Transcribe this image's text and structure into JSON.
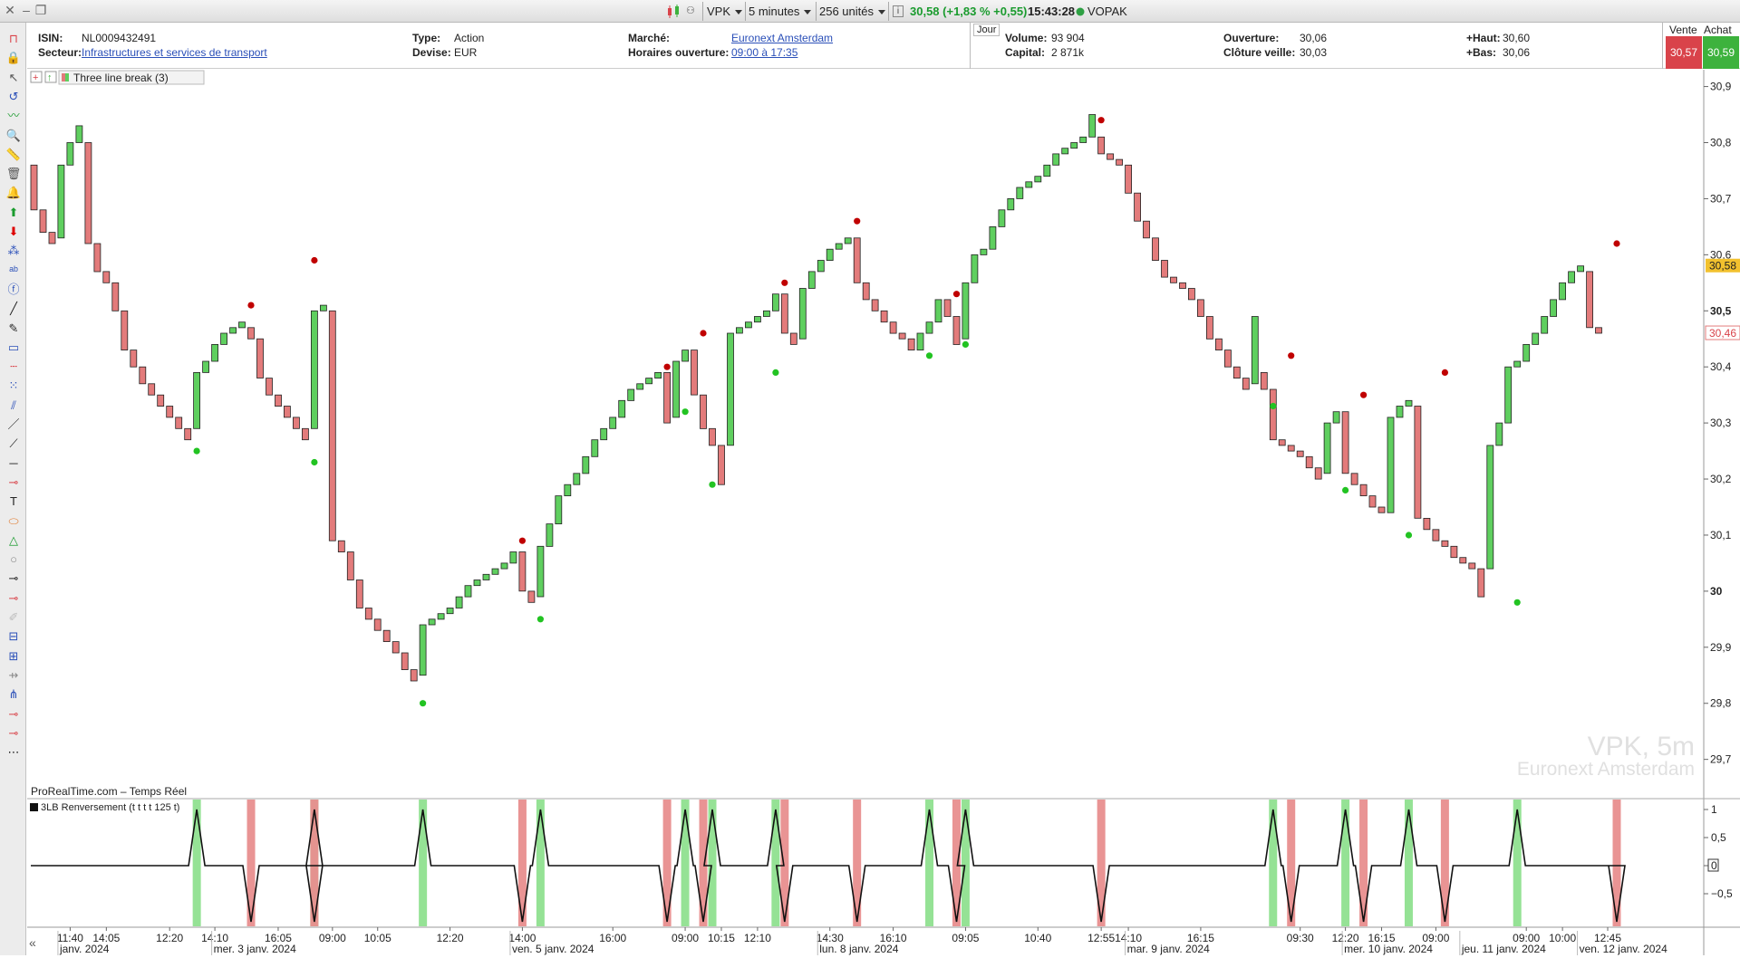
{
  "toolbar": {
    "symbol": "VPK",
    "interval": "5 minutes",
    "units": "256 unités",
    "last_price_change": "30,58 (+1,83 % +0,55)",
    "time": "15:43:28",
    "name": "VOPAK",
    "colors": {
      "positive": "#1a9b2e",
      "live_dot": "#2ea043"
    }
  },
  "info": {
    "isin_label": "ISIN:",
    "isin": "NL0009432491",
    "sector_label": "Secteur:",
    "sector": "Infrastructures et services de transport",
    "type_label": "Type:",
    "type": "Action",
    "currency_label": "Devise:",
    "currency": "EUR",
    "market_label": "Marché:",
    "market": "Euronext Amsterdam",
    "hours_label": "Horaires ouverture:",
    "hours": "09:00 à 17:35",
    "day_label": "Jour",
    "volume_label": "Volume:",
    "volume": "93 904",
    "capital_label": "Capital:",
    "capital": "2 871k",
    "open_label": "Ouverture:",
    "open": "30,06",
    "prev_close_label": "Clôture veille:",
    "prev_close": "30,03",
    "high_label": "+Haut:",
    "high": "30,60",
    "low_label": "+Bas:",
    "low": "30,06",
    "sell_label": "Vente",
    "sell": "30,57",
    "buy_label": "Achat",
    "buy": "30,59",
    "colors": {
      "sell": "#d9434a",
      "buy": "#3db23d"
    }
  },
  "left_tools": [
    "magnet-icon",
    "lock-icon",
    "cursor-icon",
    "rotate-icon",
    "trend-icon",
    "zoom-icon",
    "ruler-icon",
    "trash-icon",
    "alert-icon",
    "buy-arrow-icon",
    "sell-arrow-icon",
    "elliott-icon",
    "abc-icon",
    "fibonacci-icon",
    "pencil-icon",
    "eraser-icon",
    "rectangle-icon",
    "hline-icon",
    "pattern-icon",
    "channel-icon",
    "line-icon",
    "segment-icon",
    "horizontal-icon",
    "ray-icon",
    "text-icon",
    "ellipse-icon",
    "triangle-icon",
    "ray2-icon",
    "ray3-icon",
    "ray4-icon",
    "brush-icon",
    "fib-fan-icon",
    "gann-icon",
    "hline2-icon",
    "pitchfork-icon",
    "ray5-icon",
    "ray6-icon",
    "more-icon"
  ],
  "legend": {
    "indicator": "Three line break (3)",
    "watermark_symbol": "VPK, 5m",
    "watermark_market": "Euronext Amsterdam",
    "source": "ProRealTime.com – Temps Réel",
    "sub_indicator": "3LB Renversement (t t t t 125 t)"
  },
  "chart_data": {
    "type": "candlestick-three-line-break",
    "y_axis": {
      "ticks": [
        "30,9",
        "30,8",
        "30,7",
        "30,6",
        "30,5",
        "30,4",
        "30,3",
        "30,2",
        "30,1",
        "30",
        "29,9",
        "29,8",
        "29,7"
      ],
      "tick_values": [
        30.9,
        30.8,
        30.7,
        30.6,
        30.5,
        30.4,
        30.3,
        30.2,
        30.1,
        30.0,
        29.9,
        29.8,
        29.7
      ],
      "range": [
        29.63,
        30.93
      ]
    },
    "current_price": "30,58",
    "second_price": "30,46",
    "colors": {
      "up": "#5fcf5f",
      "down": "#e37b7b",
      "up_dot": "#22c322",
      "down_dot": "#c00000",
      "current": "#f2c12e"
    },
    "bricks": [
      [
        30.76,
        30.68,
        0
      ],
      [
        30.68,
        30.64,
        0
      ],
      [
        30.64,
        30.62,
        0
      ],
      [
        30.63,
        30.76,
        1
      ],
      [
        30.76,
        30.8,
        1
      ],
      [
        30.8,
        30.83,
        1
      ],
      [
        30.8,
        30.62,
        0
      ],
      [
        30.62,
        30.57,
        0
      ],
      [
        30.57,
        30.55,
        0
      ],
      [
        30.55,
        30.5,
        0
      ],
      [
        30.5,
        30.43,
        0
      ],
      [
        30.43,
        30.4,
        0
      ],
      [
        30.4,
        30.37,
        0
      ],
      [
        30.37,
        30.35,
        0
      ],
      [
        30.35,
        30.33,
        0
      ],
      [
        30.33,
        30.31,
        0
      ],
      [
        30.31,
        30.29,
        0
      ],
      [
        30.29,
        30.27,
        0
      ],
      [
        30.29,
        30.39,
        1
      ],
      [
        30.39,
        30.41,
        1
      ],
      [
        30.41,
        30.44,
        1
      ],
      [
        30.44,
        30.46,
        1
      ],
      [
        30.46,
        30.47,
        1
      ],
      [
        30.47,
        30.48,
        1
      ],
      [
        30.47,
        30.45,
        0
      ],
      [
        30.45,
        30.38,
        0
      ],
      [
        30.38,
        30.35,
        0
      ],
      [
        30.35,
        30.33,
        0
      ],
      [
        30.33,
        30.31,
        0
      ],
      [
        30.31,
        30.29,
        0
      ],
      [
        30.29,
        30.27,
        0
      ],
      [
        30.29,
        30.5,
        1
      ],
      [
        30.5,
        30.51,
        1
      ],
      [
        30.5,
        30.09,
        0
      ],
      [
        30.09,
        30.07,
        0
      ],
      [
        30.07,
        30.02,
        0
      ],
      [
        30.02,
        29.97,
        0
      ],
      [
        29.97,
        29.95,
        0
      ],
      [
        29.95,
        29.93,
        0
      ],
      [
        29.93,
        29.91,
        0
      ],
      [
        29.91,
        29.89,
        0
      ],
      [
        29.89,
        29.86,
        0
      ],
      [
        29.86,
        29.84,
        0
      ],
      [
        29.85,
        29.94,
        1
      ],
      [
        29.94,
        29.95,
        1
      ],
      [
        29.95,
        29.96,
        1
      ],
      [
        29.96,
        29.97,
        1
      ],
      [
        29.97,
        29.99,
        1
      ],
      [
        29.99,
        30.01,
        1
      ],
      [
        30.01,
        30.02,
        1
      ],
      [
        30.02,
        30.03,
        1
      ],
      [
        30.03,
        30.04,
        1
      ],
      [
        30.04,
        30.05,
        1
      ],
      [
        30.05,
        30.07,
        1
      ],
      [
        30.07,
        30.0,
        0
      ],
      [
        30.0,
        29.98,
        0
      ],
      [
        29.99,
        30.08,
        1
      ],
      [
        30.08,
        30.12,
        1
      ],
      [
        30.12,
        30.17,
        1
      ],
      [
        30.17,
        30.19,
        1
      ],
      [
        30.19,
        30.21,
        1
      ],
      [
        30.21,
        30.24,
        1
      ],
      [
        30.24,
        30.27,
        1
      ],
      [
        30.27,
        30.29,
        1
      ],
      [
        30.29,
        30.31,
        1
      ],
      [
        30.31,
        30.34,
        1
      ],
      [
        30.34,
        30.36,
        1
      ],
      [
        30.36,
        30.37,
        1
      ],
      [
        30.37,
        30.38,
        1
      ],
      [
        30.38,
        30.39,
        1
      ],
      [
        30.39,
        30.3,
        0
      ],
      [
        30.31,
        30.41,
        1
      ],
      [
        30.41,
        30.43,
        1
      ],
      [
        30.43,
        30.35,
        0
      ],
      [
        30.35,
        30.29,
        0
      ],
      [
        30.29,
        30.26,
        0
      ],
      [
        30.26,
        30.19,
        0
      ],
      [
        30.26,
        30.46,
        1
      ],
      [
        30.46,
        30.47,
        1
      ],
      [
        30.47,
        30.48,
        1
      ],
      [
        30.48,
        30.49,
        1
      ],
      [
        30.49,
        30.5,
        1
      ],
      [
        30.5,
        30.53,
        1
      ],
      [
        30.53,
        30.46,
        0
      ],
      [
        30.46,
        30.44,
        0
      ],
      [
        30.45,
        30.54,
        1
      ],
      [
        30.54,
        30.57,
        1
      ],
      [
        30.57,
        30.59,
        1
      ],
      [
        30.59,
        30.61,
        1
      ],
      [
        30.61,
        30.62,
        1
      ],
      [
        30.62,
        30.63,
        1
      ],
      [
        30.63,
        30.55,
        0
      ],
      [
        30.55,
        30.52,
        0
      ],
      [
        30.52,
        30.5,
        0
      ],
      [
        30.5,
        30.48,
        0
      ],
      [
        30.48,
        30.46,
        0
      ],
      [
        30.46,
        30.45,
        0
      ],
      [
        30.45,
        30.43,
        0
      ],
      [
        30.43,
        30.46,
        1
      ],
      [
        30.46,
        30.48,
        1
      ],
      [
        30.48,
        30.52,
        1
      ],
      [
        30.52,
        30.49,
        0
      ],
      [
        30.49,
        30.44,
        0
      ],
      [
        30.45,
        30.55,
        1
      ],
      [
        30.55,
        30.6,
        1
      ],
      [
        30.6,
        30.61,
        1
      ],
      [
        30.61,
        30.65,
        1
      ],
      [
        30.65,
        30.68,
        1
      ],
      [
        30.68,
        30.7,
        1
      ],
      [
        30.7,
        30.72,
        1
      ],
      [
        30.72,
        30.73,
        1
      ],
      [
        30.73,
        30.74,
        1
      ],
      [
        30.74,
        30.76,
        1
      ],
      [
        30.76,
        30.78,
        1
      ],
      [
        30.78,
        30.79,
        1
      ],
      [
        30.79,
        30.8,
        1
      ],
      [
        30.8,
        30.81,
        1
      ],
      [
        30.81,
        30.85,
        1
      ],
      [
        30.81,
        30.78,
        0
      ],
      [
        30.78,
        30.77,
        0
      ],
      [
        30.77,
        30.76,
        0
      ],
      [
        30.76,
        30.71,
        0
      ],
      [
        30.71,
        30.66,
        0
      ],
      [
        30.66,
        30.63,
        0
      ],
      [
        30.63,
        30.59,
        0
      ],
      [
        30.59,
        30.56,
        0
      ],
      [
        30.56,
        30.55,
        0
      ],
      [
        30.55,
        30.54,
        0
      ],
      [
        30.54,
        30.52,
        0
      ],
      [
        30.52,
        30.49,
        0
      ],
      [
        30.49,
        30.45,
        0
      ],
      [
        30.45,
        30.43,
        0
      ],
      [
        30.43,
        30.4,
        0
      ],
      [
        30.4,
        30.38,
        0
      ],
      [
        30.38,
        30.36,
        0
      ],
      [
        30.37,
        30.49,
        1
      ],
      [
        30.39,
        30.36,
        0
      ],
      [
        30.36,
        30.27,
        0
      ],
      [
        30.27,
        30.26,
        0
      ],
      [
        30.26,
        30.25,
        0
      ],
      [
        30.25,
        30.24,
        0
      ],
      [
        30.24,
        30.22,
        0
      ],
      [
        30.22,
        30.2,
        0
      ],
      [
        30.21,
        30.3,
        1
      ],
      [
        30.3,
        30.32,
        1
      ],
      [
        30.32,
        30.21,
        0
      ],
      [
        30.21,
        30.19,
        0
      ],
      [
        30.19,
        30.17,
        0
      ],
      [
        30.17,
        30.15,
        0
      ],
      [
        30.15,
        30.14,
        0
      ],
      [
        30.14,
        30.31,
        1
      ],
      [
        30.31,
        30.33,
        1
      ],
      [
        30.33,
        30.34,
        1
      ],
      [
        30.33,
        30.13,
        0
      ],
      [
        30.13,
        30.11,
        0
      ],
      [
        30.11,
        30.09,
        0
      ],
      [
        30.09,
        30.08,
        0
      ],
      [
        30.08,
        30.06,
        0
      ],
      [
        30.06,
        30.05,
        0
      ],
      [
        30.05,
        30.04,
        0
      ],
      [
        30.04,
        29.99,
        0
      ],
      [
        30.04,
        30.26,
        1
      ],
      [
        30.26,
        30.3,
        1
      ],
      [
        30.3,
        30.4,
        1
      ],
      [
        30.4,
        30.41,
        1
      ],
      [
        30.41,
        30.44,
        1
      ],
      [
        30.44,
        30.46,
        1
      ],
      [
        30.46,
        30.49,
        1
      ],
      [
        30.49,
        30.52,
        1
      ],
      [
        30.52,
        30.55,
        1
      ],
      [
        30.55,
        30.57,
        1
      ],
      [
        30.57,
        30.58,
        1
      ],
      [
        30.57,
        30.47,
        0
      ],
      [
        30.47,
        30.46,
        0
      ]
    ],
    "down_signals": [
      [
        24,
        30.51
      ],
      [
        31,
        30.59
      ],
      [
        54,
        30.09
      ],
      [
        70,
        30.4
      ],
      [
        74,
        30.46
      ],
      [
        83,
        30.55
      ],
      [
        91,
        30.66
      ],
      [
        102,
        30.53
      ],
      [
        118,
        30.84
      ],
      [
        139,
        30.42
      ],
      [
        147,
        30.35
      ],
      [
        156,
        30.39
      ],
      [
        175,
        30.62
      ]
    ],
    "up_signals": [
      [
        18,
        30.25
      ],
      [
        31,
        30.23
      ],
      [
        43,
        29.8
      ],
      [
        56,
        29.95
      ],
      [
        72,
        30.32
      ],
      [
        75,
        30.19
      ],
      [
        82,
        30.39
      ],
      [
        99,
        30.42
      ],
      [
        103,
        30.44
      ],
      [
        137,
        30.33
      ],
      [
        145,
        30.18
      ],
      [
        152,
        30.1
      ],
      [
        164,
        29.98
      ]
    ],
    "x_labels": [
      {
        "i": 4,
        "t": "11:40"
      },
      {
        "i": 8,
        "t": "14:05"
      },
      {
        "i": 15,
        "t": "12:20"
      },
      {
        "i": 20,
        "t": "14:10"
      },
      {
        "i": 27,
        "t": "16:05"
      },
      {
        "i": 33,
        "t": "09:00"
      },
      {
        "i": 38,
        "t": "10:05"
      },
      {
        "i": 46,
        "t": "12:20"
      },
      {
        "i": 54,
        "t": "14:00"
      },
      {
        "i": 64,
        "t": "16:00"
      },
      {
        "i": 72,
        "t": "09:00"
      },
      {
        "i": 76,
        "t": "10:15"
      },
      {
        "i": 80,
        "t": "12:10"
      },
      {
        "i": 88,
        "t": "14:30"
      },
      {
        "i": 95,
        "t": "16:10"
      },
      {
        "i": 103,
        "t": "09:05"
      },
      {
        "i": 111,
        "t": "10:40"
      },
      {
        "i": 118,
        "t": "12:55"
      },
      {
        "i": 121,
        "t": "14:10"
      },
      {
        "i": 129,
        "t": "16:15"
      },
      {
        "i": 140,
        "t": "09:30"
      },
      {
        "i": 145,
        "t": "12:20"
      },
      {
        "i": 149,
        "t": "16:15"
      },
      {
        "i": 155,
        "t": "09:00"
      },
      {
        "i": 165,
        "t": "09:00"
      },
      {
        "i": 169,
        "t": "10:00"
      },
      {
        "i": 174,
        "t": "12:45"
      }
    ],
    "date_labels": [
      {
        "i": 3,
        "t": "janv. 2024"
      },
      {
        "i": 20,
        "t": "mer. 3 janv. 2024"
      },
      {
        "i": 53,
        "t": "ven. 5 janv. 2024"
      },
      {
        "i": 87,
        "t": "lun. 8 janv. 2024"
      },
      {
        "i": 121,
        "t": "mar. 9 janv. 2024"
      },
      {
        "i": 145,
        "t": "mer. 10 janv. 2024"
      },
      {
        "i": 158,
        "t": "jeu. 11 janv. 2024"
      },
      {
        "i": 171,
        "t": "ven. 12 janv. 2024"
      }
    ],
    "osc_ticks": [
      "1",
      "0,5",
      "0",
      "−0,5"
    ],
    "osc_tick_values": [
      1,
      0.5,
      0,
      -0.5
    ]
  }
}
